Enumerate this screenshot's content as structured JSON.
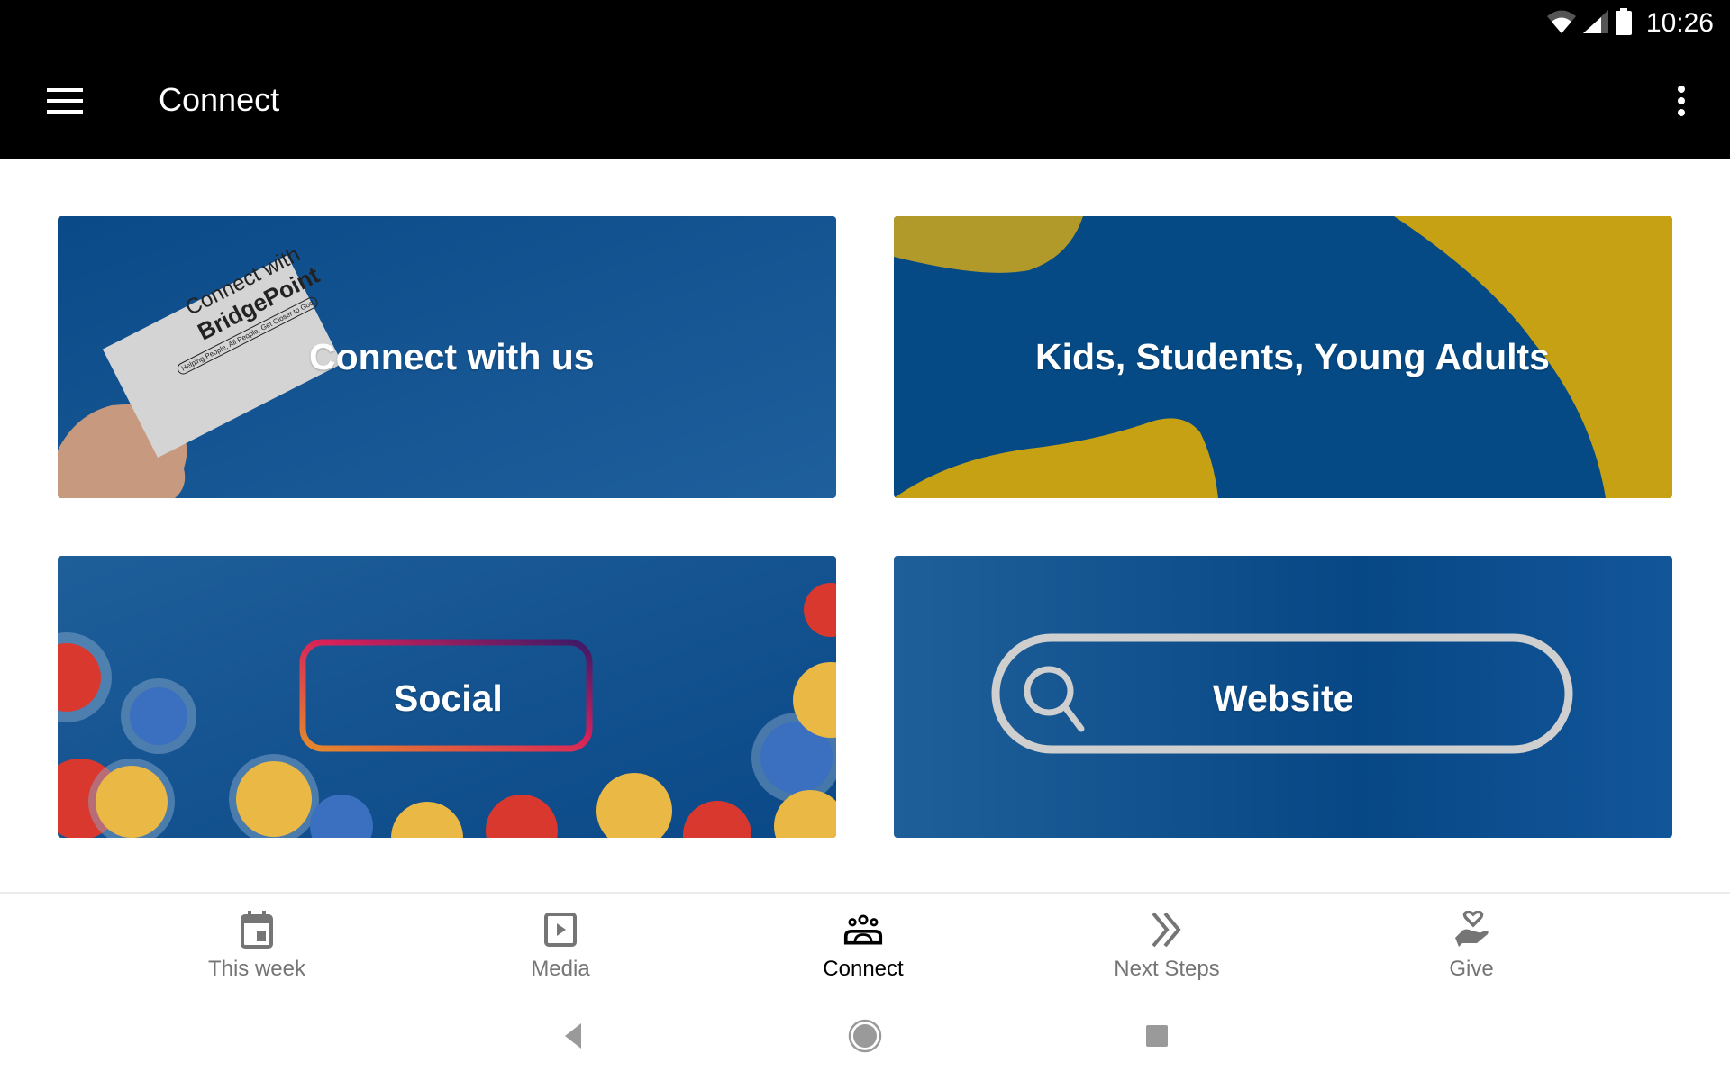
{
  "status_bar": {
    "time": "10:26",
    "icons": [
      "wifi-icon",
      "signal-icon",
      "battery-icon"
    ]
  },
  "app_bar": {
    "title": "Connect",
    "menu_icon": "hamburger-menu-icon",
    "overflow_icon": "more-vertical-icon"
  },
  "cards": [
    {
      "title": "Connect with us",
      "image_text": {
        "line1": "Connect with",
        "line2": "BridgePoint",
        "tagline": "Helping People, All People, Get Closer to God"
      }
    },
    {
      "title": "Kids, Students, Young Adults"
    },
    {
      "title": "Social"
    },
    {
      "title": "Website"
    }
  ],
  "bottom_nav": {
    "items": [
      {
        "label": "This week",
        "icon": "calendar-icon",
        "active": false
      },
      {
        "label": "Media",
        "icon": "play-box-icon",
        "active": false
      },
      {
        "label": "Connect",
        "icon": "group-icon",
        "active": true
      },
      {
        "label": "Next Steps",
        "icon": "double-chevron-right-icon",
        "active": false
      },
      {
        "label": "Give",
        "icon": "hand-heart-icon",
        "active": false
      }
    ]
  },
  "colors": {
    "brand_blue": "#0b4d8c",
    "brand_gold": "#c7a114",
    "active_nav": "#000000",
    "inactive_nav": "#757575"
  }
}
